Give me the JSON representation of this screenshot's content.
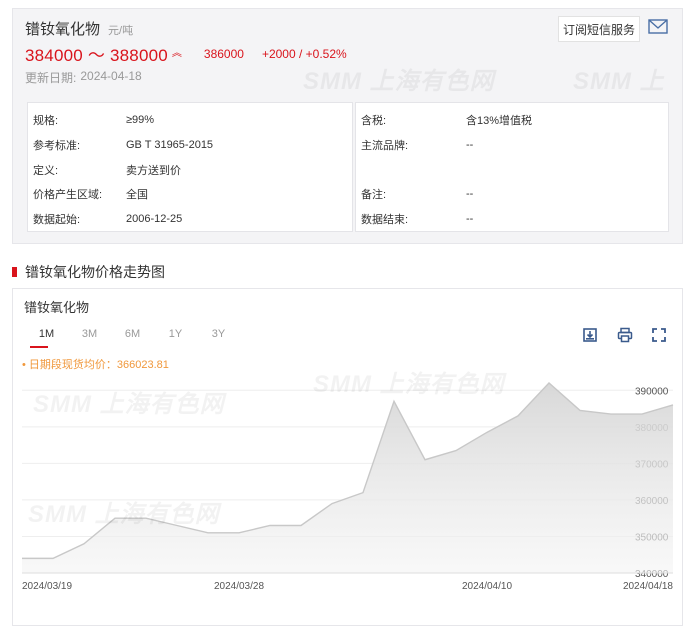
{
  "product": {
    "name": "镨钕氧化物",
    "unit": "元/吨",
    "price_range": "384000 ～ 388000",
    "average": "386000",
    "change": "+2000 / +0.52%",
    "update_label": "更新日期:",
    "update_date": "2024-04-18",
    "subscribe_label": "订阅短信服务"
  },
  "specs_left": [
    {
      "k": "规格:",
      "v": "≥99%"
    },
    {
      "k": "参考标准:",
      "v": "GB T 31965-2015"
    },
    {
      "k": "定义:",
      "v": "卖方送到价"
    },
    {
      "k": "价格产生区域:",
      "v": "全国"
    },
    {
      "k": "数据起始:",
      "v": "2006-12-25"
    }
  ],
  "specs_right": [
    {
      "k": "含税:",
      "v": "含13%增值税"
    },
    {
      "k": "主流品牌:",
      "v": "--"
    },
    {
      "k": "",
      "v": ""
    },
    {
      "k": "备注:",
      "v": "--"
    },
    {
      "k": "数据结束:",
      "v": "--"
    }
  ],
  "watermark_text": "SMM 上海有色网",
  "section_title": "镨钕氧化物价格走势图",
  "chart_card": {
    "title": "镨钕氧化物",
    "tabs": [
      "1M",
      "3M",
      "6M",
      "1Y",
      "3Y"
    ],
    "active_tab": "1M",
    "avg_note": "• 日期段现货均价：366023.81"
  },
  "colors": {
    "accent_red": "#d9141c",
    "avg_note": "#f0983c",
    "line": "#c8c8c8"
  },
  "chart_data": {
    "type": "area",
    "x": [
      "2024/03/19",
      "2024/03/20",
      "2024/03/21",
      "2024/03/22",
      "2024/03/25",
      "2024/03/26",
      "2024/03/27",
      "2024/03/28",
      "2024/03/29",
      "2024/04/01",
      "2024/04/02",
      "2024/04/03",
      "2024/04/07",
      "2024/04/08",
      "2024/04/09",
      "2024/04/10",
      "2024/04/11",
      "2024/04/12",
      "2024/04/15",
      "2024/04/16",
      "2024/04/17",
      "2024/04/18"
    ],
    "values": [
      344000,
      344000,
      348000,
      355000,
      355000,
      353000,
      351000,
      351000,
      353000,
      353000,
      359000,
      362000,
      387000,
      371000,
      373500,
      378500,
      383000,
      392000,
      384500,
      383500,
      383500,
      386000
    ],
    "ylim": [
      340000,
      392000
    ],
    "yticks": [
      "340000",
      "350000",
      "360000",
      "370000",
      "380000",
      "390000"
    ],
    "xtick_labels": [
      "2024/03/19",
      "2024/03/28",
      "2024/04/10",
      "2024/04/18"
    ],
    "xtick_index": [
      0,
      7,
      15,
      21
    ],
    "title": "镨钕氧化物",
    "xlabel": "",
    "ylabel": "",
    "grid": true
  }
}
